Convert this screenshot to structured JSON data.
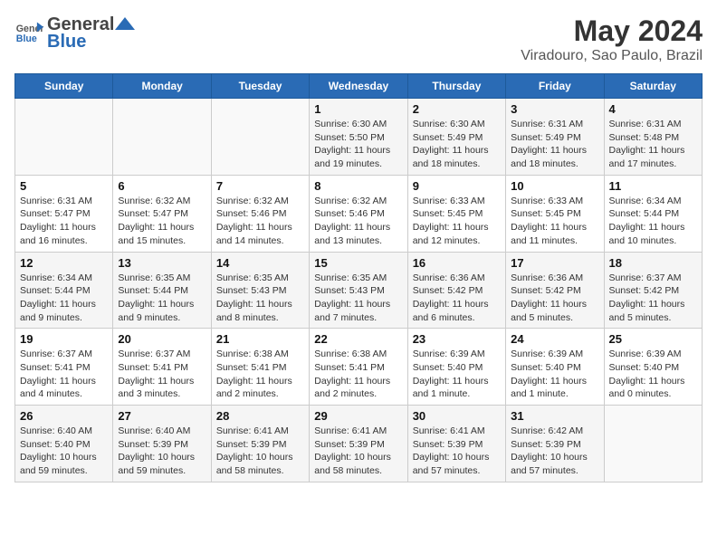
{
  "header": {
    "logo_line1": "General",
    "logo_line2": "Blue",
    "month_year": "May 2024",
    "location": "Viradouro, Sao Paulo, Brazil"
  },
  "days_of_week": [
    "Sunday",
    "Monday",
    "Tuesday",
    "Wednesday",
    "Thursday",
    "Friday",
    "Saturday"
  ],
  "weeks": [
    [
      {
        "day": "",
        "info": ""
      },
      {
        "day": "",
        "info": ""
      },
      {
        "day": "",
        "info": ""
      },
      {
        "day": "1",
        "info": "Sunrise: 6:30 AM\nSunset: 5:50 PM\nDaylight: 11 hours\nand 19 minutes."
      },
      {
        "day": "2",
        "info": "Sunrise: 6:30 AM\nSunset: 5:49 PM\nDaylight: 11 hours\nand 18 minutes."
      },
      {
        "day": "3",
        "info": "Sunrise: 6:31 AM\nSunset: 5:49 PM\nDaylight: 11 hours\nand 18 minutes."
      },
      {
        "day": "4",
        "info": "Sunrise: 6:31 AM\nSunset: 5:48 PM\nDaylight: 11 hours\nand 17 minutes."
      }
    ],
    [
      {
        "day": "5",
        "info": "Sunrise: 6:31 AM\nSunset: 5:47 PM\nDaylight: 11 hours\nand 16 minutes."
      },
      {
        "day": "6",
        "info": "Sunrise: 6:32 AM\nSunset: 5:47 PM\nDaylight: 11 hours\nand 15 minutes."
      },
      {
        "day": "7",
        "info": "Sunrise: 6:32 AM\nSunset: 5:46 PM\nDaylight: 11 hours\nand 14 minutes."
      },
      {
        "day": "8",
        "info": "Sunrise: 6:32 AM\nSunset: 5:46 PM\nDaylight: 11 hours\nand 13 minutes."
      },
      {
        "day": "9",
        "info": "Sunrise: 6:33 AM\nSunset: 5:45 PM\nDaylight: 11 hours\nand 12 minutes."
      },
      {
        "day": "10",
        "info": "Sunrise: 6:33 AM\nSunset: 5:45 PM\nDaylight: 11 hours\nand 11 minutes."
      },
      {
        "day": "11",
        "info": "Sunrise: 6:34 AM\nSunset: 5:44 PM\nDaylight: 11 hours\nand 10 minutes."
      }
    ],
    [
      {
        "day": "12",
        "info": "Sunrise: 6:34 AM\nSunset: 5:44 PM\nDaylight: 11 hours\nand 9 minutes."
      },
      {
        "day": "13",
        "info": "Sunrise: 6:35 AM\nSunset: 5:44 PM\nDaylight: 11 hours\nand 9 minutes."
      },
      {
        "day": "14",
        "info": "Sunrise: 6:35 AM\nSunset: 5:43 PM\nDaylight: 11 hours\nand 8 minutes."
      },
      {
        "day": "15",
        "info": "Sunrise: 6:35 AM\nSunset: 5:43 PM\nDaylight: 11 hours\nand 7 minutes."
      },
      {
        "day": "16",
        "info": "Sunrise: 6:36 AM\nSunset: 5:42 PM\nDaylight: 11 hours\nand 6 minutes."
      },
      {
        "day": "17",
        "info": "Sunrise: 6:36 AM\nSunset: 5:42 PM\nDaylight: 11 hours\nand 5 minutes."
      },
      {
        "day": "18",
        "info": "Sunrise: 6:37 AM\nSunset: 5:42 PM\nDaylight: 11 hours\nand 5 minutes."
      }
    ],
    [
      {
        "day": "19",
        "info": "Sunrise: 6:37 AM\nSunset: 5:41 PM\nDaylight: 11 hours\nand 4 minutes."
      },
      {
        "day": "20",
        "info": "Sunrise: 6:37 AM\nSunset: 5:41 PM\nDaylight: 11 hours\nand 3 minutes."
      },
      {
        "day": "21",
        "info": "Sunrise: 6:38 AM\nSunset: 5:41 PM\nDaylight: 11 hours\nand 2 minutes."
      },
      {
        "day": "22",
        "info": "Sunrise: 6:38 AM\nSunset: 5:41 PM\nDaylight: 11 hours\nand 2 minutes."
      },
      {
        "day": "23",
        "info": "Sunrise: 6:39 AM\nSunset: 5:40 PM\nDaylight: 11 hours\nand 1 minute."
      },
      {
        "day": "24",
        "info": "Sunrise: 6:39 AM\nSunset: 5:40 PM\nDaylight: 11 hours\nand 1 minute."
      },
      {
        "day": "25",
        "info": "Sunrise: 6:39 AM\nSunset: 5:40 PM\nDaylight: 11 hours\nand 0 minutes."
      }
    ],
    [
      {
        "day": "26",
        "info": "Sunrise: 6:40 AM\nSunset: 5:40 PM\nDaylight: 10 hours\nand 59 minutes."
      },
      {
        "day": "27",
        "info": "Sunrise: 6:40 AM\nSunset: 5:39 PM\nDaylight: 10 hours\nand 59 minutes."
      },
      {
        "day": "28",
        "info": "Sunrise: 6:41 AM\nSunset: 5:39 PM\nDaylight: 10 hours\nand 58 minutes."
      },
      {
        "day": "29",
        "info": "Sunrise: 6:41 AM\nSunset: 5:39 PM\nDaylight: 10 hours\nand 58 minutes."
      },
      {
        "day": "30",
        "info": "Sunrise: 6:41 AM\nSunset: 5:39 PM\nDaylight: 10 hours\nand 57 minutes."
      },
      {
        "day": "31",
        "info": "Sunrise: 6:42 AM\nSunset: 5:39 PM\nDaylight: 10 hours\nand 57 minutes."
      },
      {
        "day": "",
        "info": ""
      }
    ]
  ]
}
